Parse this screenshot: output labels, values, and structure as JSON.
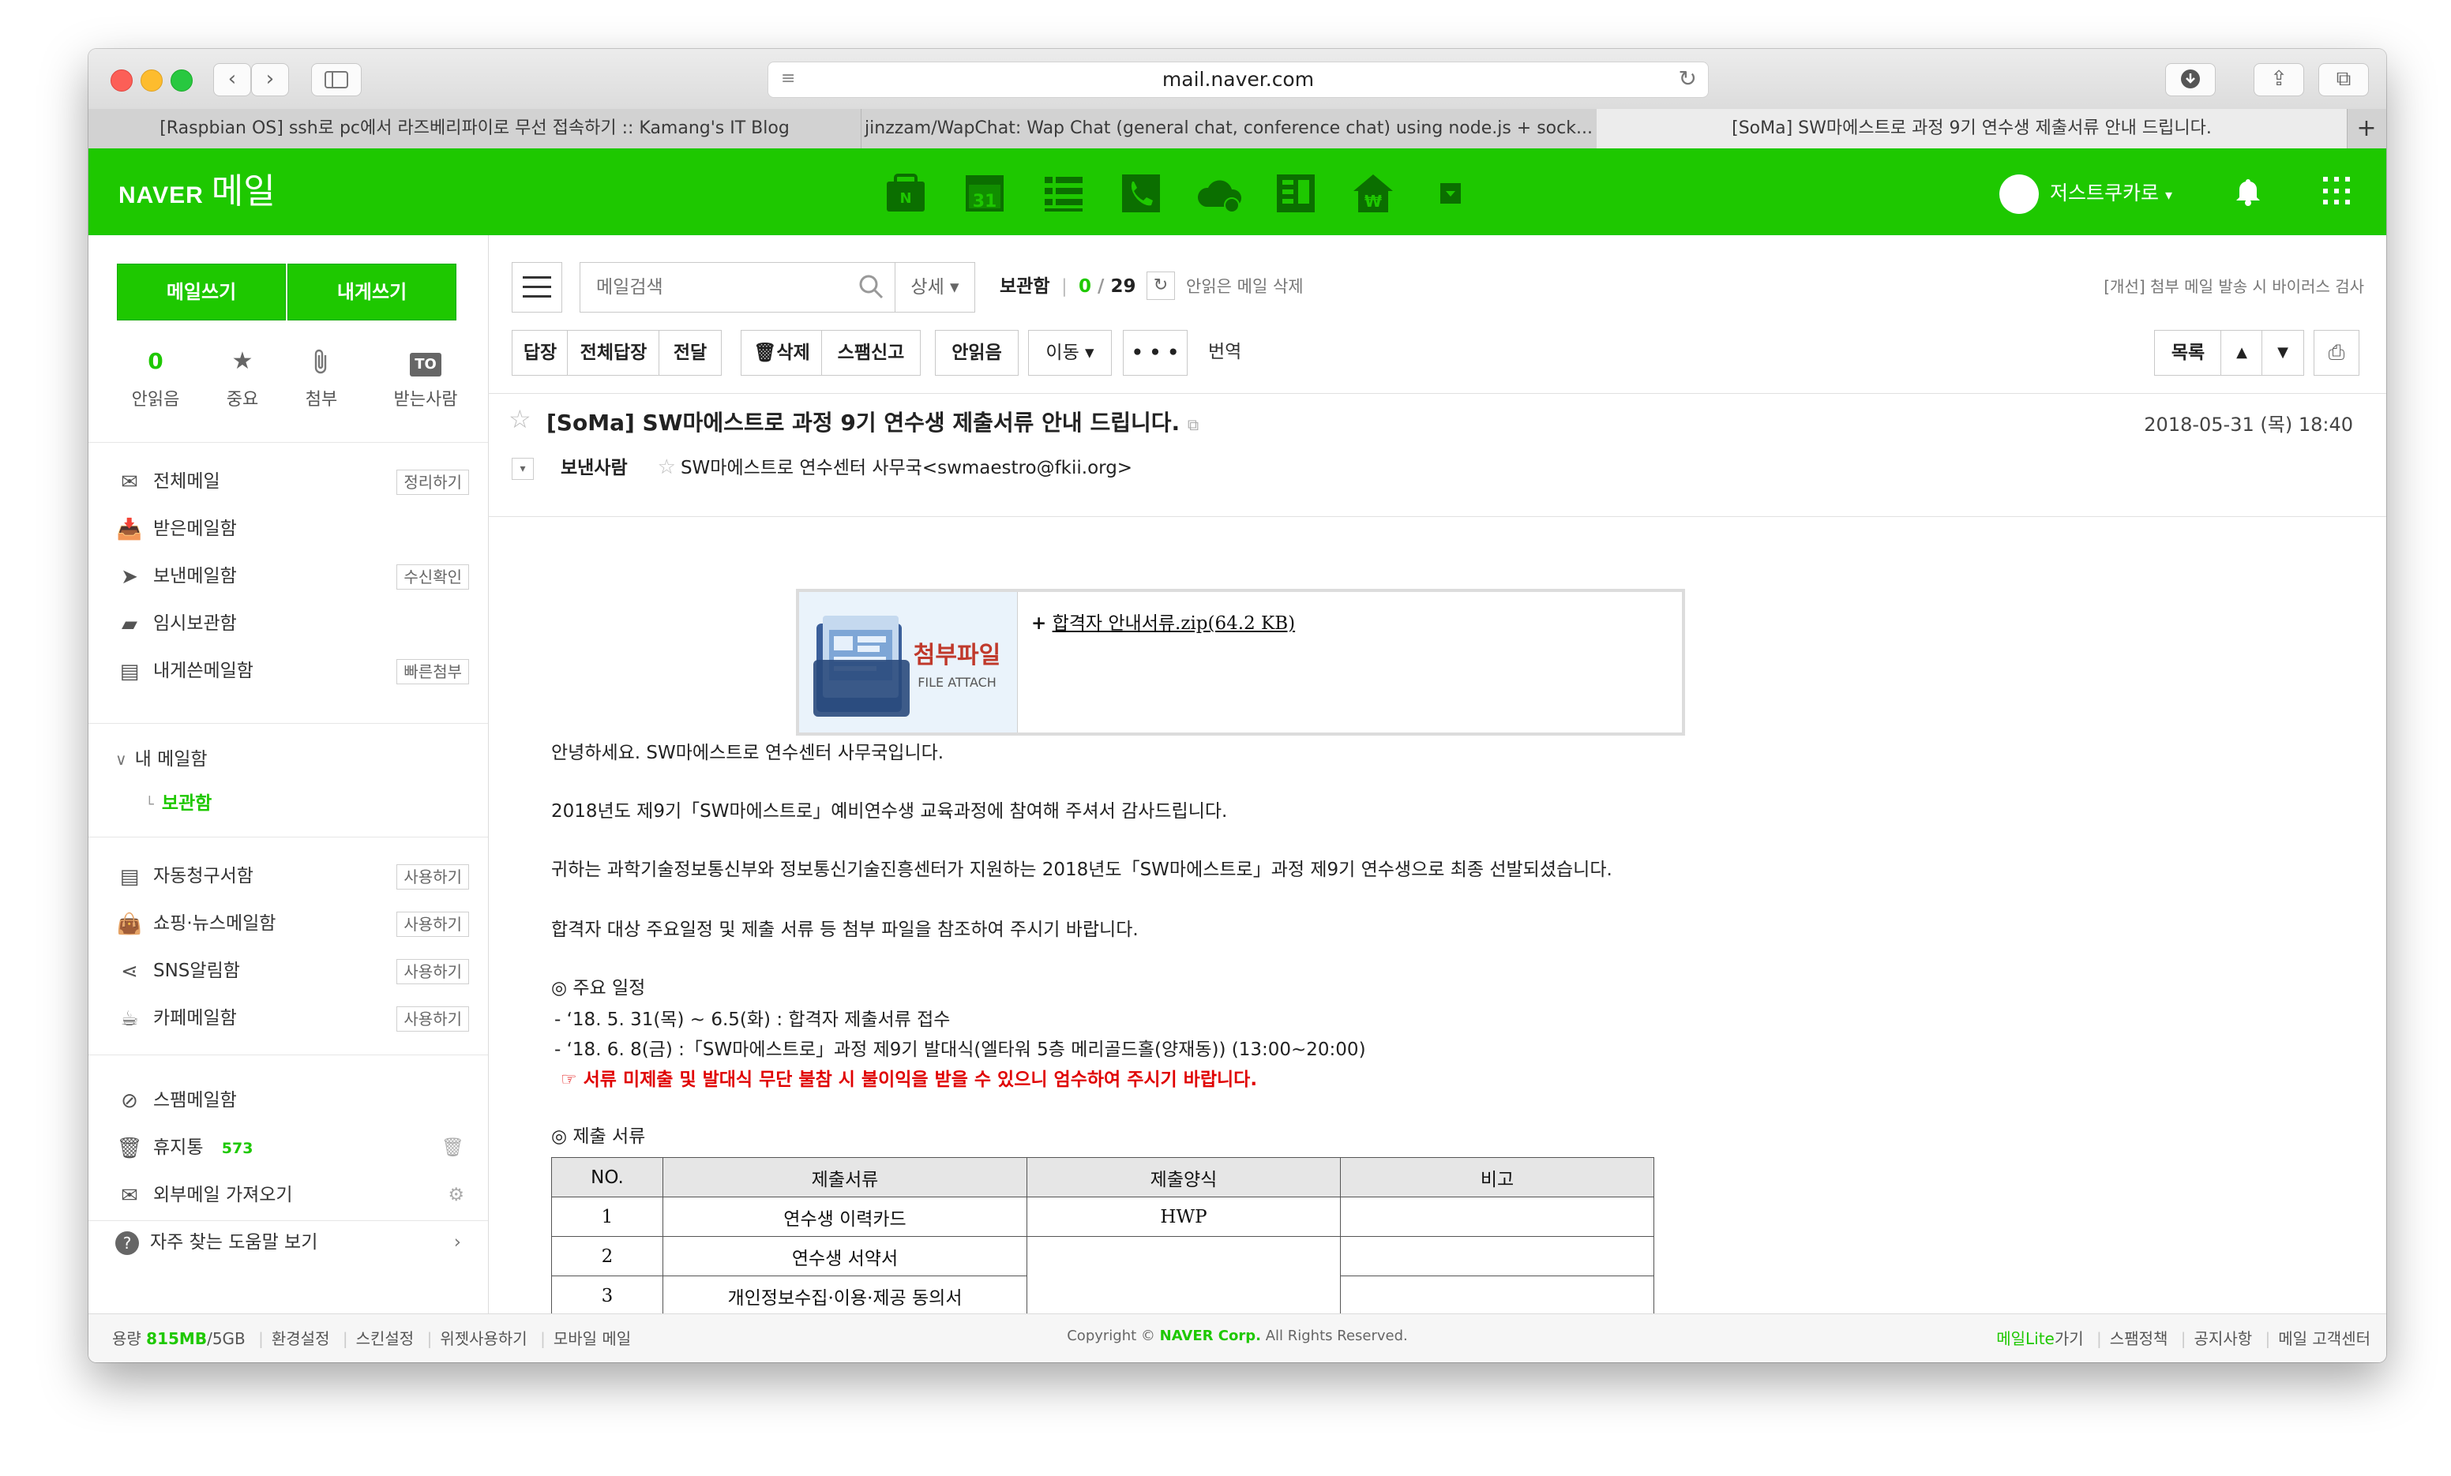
{
  "browser": {
    "url": "mail.naver.com",
    "tabs": [
      "[Raspbian OS] ssh로 pc에서 라즈베리파이로 무선 접속하기 :: Kamang's IT Blog",
      "jinzzam/WapChat: Wap Chat (general chat, conference chat) using node.js + sock...",
      "[SoMa] SW마에스트로 과정 9기 연수생 제출서류 안내 드립니다."
    ]
  },
  "header": {
    "logo_naver": "NAVER",
    "logo_mail": "메일",
    "user_name": "저스트쿠카로",
    "app_icons": [
      "mail-app-icon",
      "calendar-app-icon",
      "memo-app-icon",
      "contacts-app-icon",
      "cloud-app-icon",
      "office-app-icon",
      "household-account-icon",
      "more-apps-icon"
    ],
    "calendar_number": "31"
  },
  "sidebar": {
    "compose": "메일쓰기",
    "self_compose": "내게쓰기",
    "quick": {
      "unread_count": "0",
      "unread_label": "안읽음",
      "important_label": "중요",
      "attach_label": "첨부",
      "to_badge": "TO",
      "to_label": "받는사람"
    },
    "folders": [
      {
        "label": "전체메일",
        "action": "정리하기"
      },
      {
        "label": "받은메일함",
        "action": ""
      },
      {
        "label": "보낸메일함",
        "action": "수신확인"
      },
      {
        "label": "임시보관함",
        "action": ""
      },
      {
        "label": "내게쓴메일함",
        "action": "빠른첨부"
      }
    ],
    "my_mailbox": "내 메일함",
    "storage_folder": "보관함",
    "services": [
      {
        "label": "자동청구서함",
        "action": "사용하기"
      },
      {
        "label": "쇼핑·뉴스메일함",
        "action": "사용하기"
      },
      {
        "label": "SNS알림함",
        "action": "사용하기"
      },
      {
        "label": "카페메일함",
        "action": "사용하기"
      }
    ],
    "spam": "스팸메일함",
    "trash": "휴지통",
    "trash_count": "573",
    "external": "외부메일 가져오기",
    "help": "자주 찾는 도움말 보기"
  },
  "toolbar": {
    "search_placeholder": "메일검색",
    "detail": "상세",
    "folder_name": "보관함",
    "unread": "0",
    "total": "29",
    "delete_unread": "안읽은 메일 삭제",
    "virus_notice": "[개선] 첨부 메일 발송 시 바이러스 검사",
    "reply": "답장",
    "reply_all": "전체답장",
    "forward": "전달",
    "delete": "삭제",
    "spam_report": "스팸신고",
    "mark_unread": "안읽음",
    "move": "이동",
    "more": "• • •",
    "translate": "번역",
    "list": "목록"
  },
  "message": {
    "subject": "[SoMa] SW마에스트로 과정 9기 연수생 제출서류 안내 드립니다.",
    "date": "2018-05-31 (목) 18:40",
    "sender_label": "보낸사람",
    "sender": "SW마에스트로 연수센터 사무국<swmaestro@fkii.org>",
    "attachment_title": "첨부파일",
    "attachment_subtitle": "FILE ATTACH",
    "attachment_link": "합격자 안내서류.zip(64.2 KB)",
    "paragraphs": [
      "안녕하세요. SW마에스트로 연수센터 사무국입니다.",
      "2018년도 제9기「SW마에스트로」예비연수생 교육과정에 참여해 주셔서 감사드립니다.",
      "귀하는 과학기술정보통신부와 정보통신기술진흥센터가 지원하는 2018년도「SW마에스트로」과정 제9기 연수생으로 최종 선발되셨습니다.",
      "합격자 대상 주요일정 및 제출 서류 등 첨부 파일을 참조하여 주시기 바랍니다."
    ],
    "schedule_title": "◎ 주요 일정",
    "schedule": [
      "- ‘18. 5. 31(목) ~ 6.5(화) : 합격자 제출서류 접수",
      "- ‘18. 6. 8(금) :「SW마에스트로」과정 제9기 발대식(엘타워 5층 메리골드홀(양재동)) (13:00~20:00)"
    ],
    "warning": "☞ 서류 미제출 및 발대식 무단 불참 시 불이익을 받을 수 있으니 엄수하여 주시기 바랍니다.",
    "docs_title": "◎ 제출 서류",
    "table": {
      "headers": [
        "NO.",
        "제출서류",
        "제출양식",
        "비고"
      ],
      "rows": [
        [
          "1",
          "연수생 이력카드",
          "HWP",
          ""
        ],
        [
          "2",
          "연수생 서약서",
          "",
          ""
        ],
        [
          "3",
          "개인정보수집·이용·제공 동의서",
          "",
          ""
        ]
      ]
    }
  },
  "footer": {
    "capacity_label": "용량",
    "capacity_used": "815MB",
    "capacity_total": "/5GB",
    "links_left": [
      "환경설정",
      "스킨설정",
      "위젯사용하기",
      "모바일 메일"
    ],
    "copyright_pre": "Copyright ©",
    "copyright_company": "NAVER Corp.",
    "copyright_post": "All Rights Reserved.",
    "lite_green": "메일Lite",
    "lite_rest": "가기",
    "links_right": [
      "스팸정책",
      "공지사항",
      "메일 고객센터"
    ]
  },
  "colors": {
    "naver_green": "#1ec800",
    "warning_red": "#e00000"
  }
}
